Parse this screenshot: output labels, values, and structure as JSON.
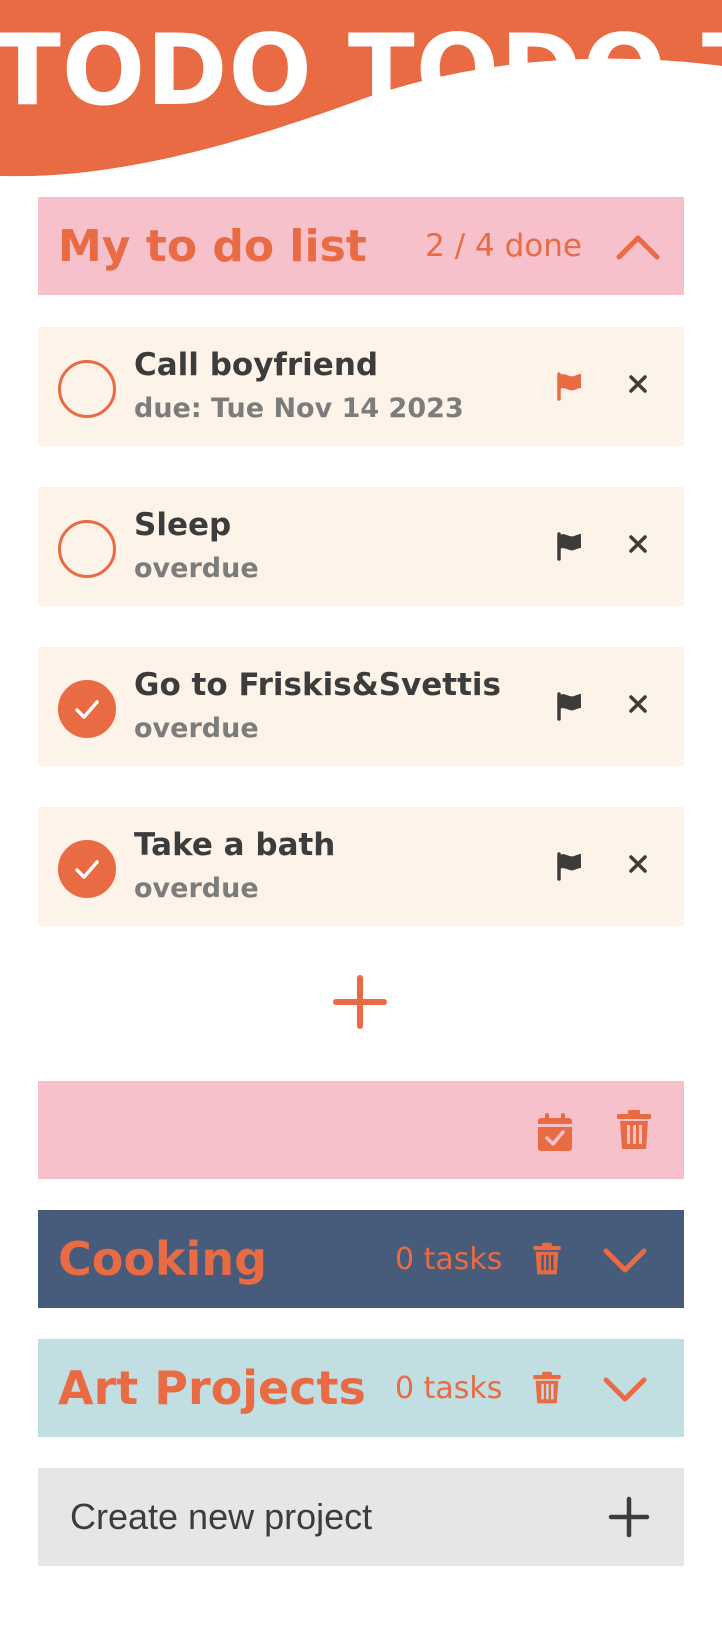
{
  "app": {
    "title": "TODO TODO T",
    "brand_color": "#e96b44"
  },
  "main_project": {
    "name": "My to do list",
    "progress_text": "2 / 4 done",
    "completed": 2,
    "total": 4,
    "expanded": true,
    "color": "#f6c1cb"
  },
  "tasks": [
    {
      "title": "Call boyfriend",
      "subtitle": "due: Tue Nov 14 2023",
      "done": false,
      "flagged": true
    },
    {
      "title": "Sleep",
      "subtitle": "overdue",
      "done": false,
      "flagged": false
    },
    {
      "title": "Go to Friskis&Svettis",
      "subtitle": "overdue",
      "done": true,
      "flagged": false
    },
    {
      "title": "Take a bath",
      "subtitle": "overdue",
      "done": true,
      "flagged": false
    }
  ],
  "actions": {
    "add_task_icon": "plus-icon",
    "calendar_icon": "calendar-check-icon",
    "delete_project_icon": "trash-icon"
  },
  "projects": [
    {
      "name": "Cooking",
      "count_text": "0 tasks",
      "color": "#475b7b",
      "expanded": false
    },
    {
      "name": "Art Projects",
      "count_text": "0 tasks",
      "color": "#c1dfe2",
      "expanded": false
    }
  ],
  "create_project": {
    "label": "Create new project",
    "icon": "plus-icon"
  }
}
